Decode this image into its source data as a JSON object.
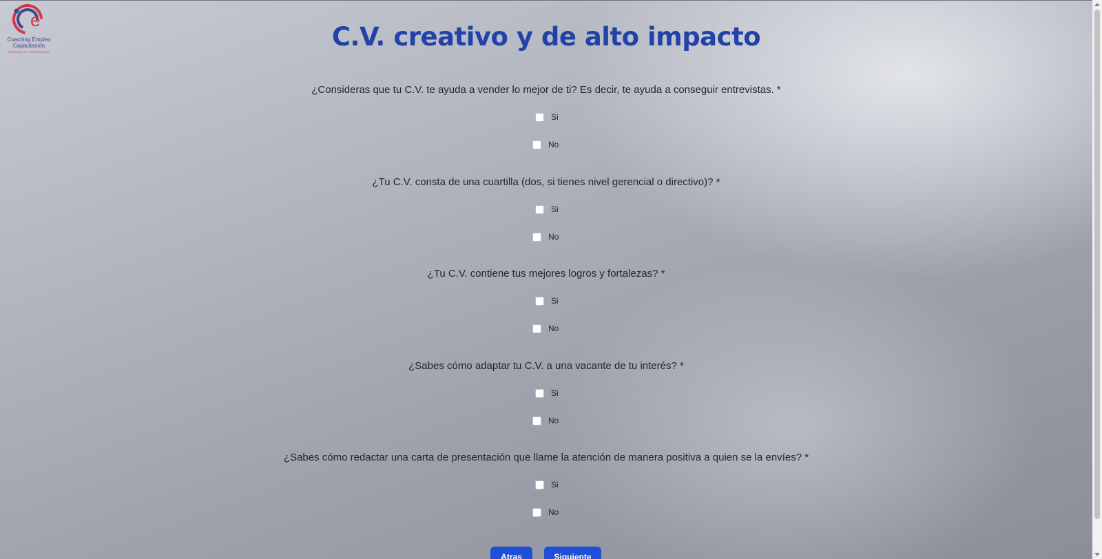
{
  "logo": {
    "line1": "Coaching Empleo",
    "line2": "Capacitación",
    "line3": "DESARROLLO PROFESIONAL"
  },
  "page_title": "C.V. creativo y de alto impacto",
  "questions": [
    {
      "text": "¿Consideras que tu C.V. te ayuda a vender lo mejor de ti? Es decir, te ayuda a conseguir entrevistas. *",
      "options": [
        "Si",
        "No"
      ]
    },
    {
      "text": "¿Tu C.V. consta de una cuartilla (dos, si tienes nivel gerencial o directivo)? *",
      "options": [
        "Si",
        "No"
      ]
    },
    {
      "text": "¿Tu C.V. contiene tus mejores logros y fortalezas? *",
      "options": [
        "Si",
        "No"
      ]
    },
    {
      "text": "¿Sabes cómo adaptar tu C.V. a una vacante de tu interés? *",
      "options": [
        "Si",
        "No"
      ]
    },
    {
      "text": "¿Sabes cómo redactar una carta de presentación que llame la atención de manera positiva a quien se la envíes? *",
      "options": [
        "Si",
        "No"
      ]
    }
  ],
  "buttons": {
    "back_label": "Atras",
    "next_label": "Siguiente"
  },
  "colors": {
    "title": "#2342a8",
    "button": "#1f4fd6",
    "logo_red": "#d9334a",
    "logo_blue": "#3a4a8a"
  }
}
